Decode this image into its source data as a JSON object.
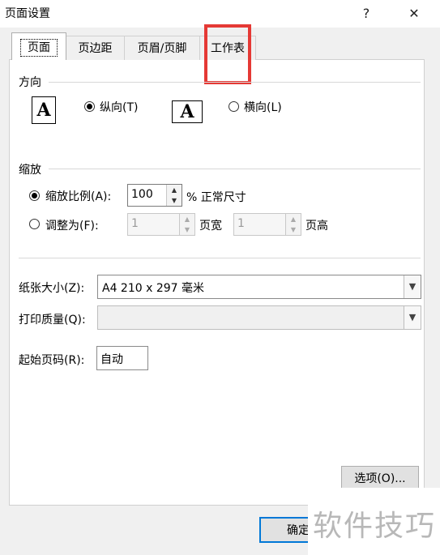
{
  "window": {
    "title": "页面设置",
    "help_glyph": "?",
    "close_glyph": "✕"
  },
  "tabs": [
    {
      "label": "页面",
      "active": true
    },
    {
      "label": "页边距",
      "active": false
    },
    {
      "label": "页眉/页脚",
      "active": false
    },
    {
      "label": "工作表",
      "active": false
    }
  ],
  "orientation": {
    "group_title": "方向",
    "portrait_label": "纵向(T)",
    "landscape_label": "横向(L)",
    "selected": "portrait",
    "icon_letter": "A"
  },
  "scaling": {
    "group_title": "缩放",
    "adjust_label": "缩放比例(A):",
    "adjust_value": "100",
    "adjust_suffix": "% 正常尺寸",
    "fit_label": "调整为(F):",
    "fit_wide_value": "1",
    "fit_wide_suffix": "页宽",
    "fit_tall_value": "1",
    "fit_tall_suffix": "页高",
    "selected": "adjust"
  },
  "paper": {
    "size_label": "纸张大小(Z):",
    "size_value": "A4 210 x 297 毫米",
    "quality_label": "打印质量(Q):",
    "quality_value": "",
    "first_page_label": "起始页码(R):",
    "first_page_value": "自动"
  },
  "buttons": {
    "options": "选项(O)...",
    "ok": "确定"
  },
  "watermark": "软件技巧",
  "colors": {
    "highlight": "#e53935",
    "accent": "#0078d7"
  }
}
